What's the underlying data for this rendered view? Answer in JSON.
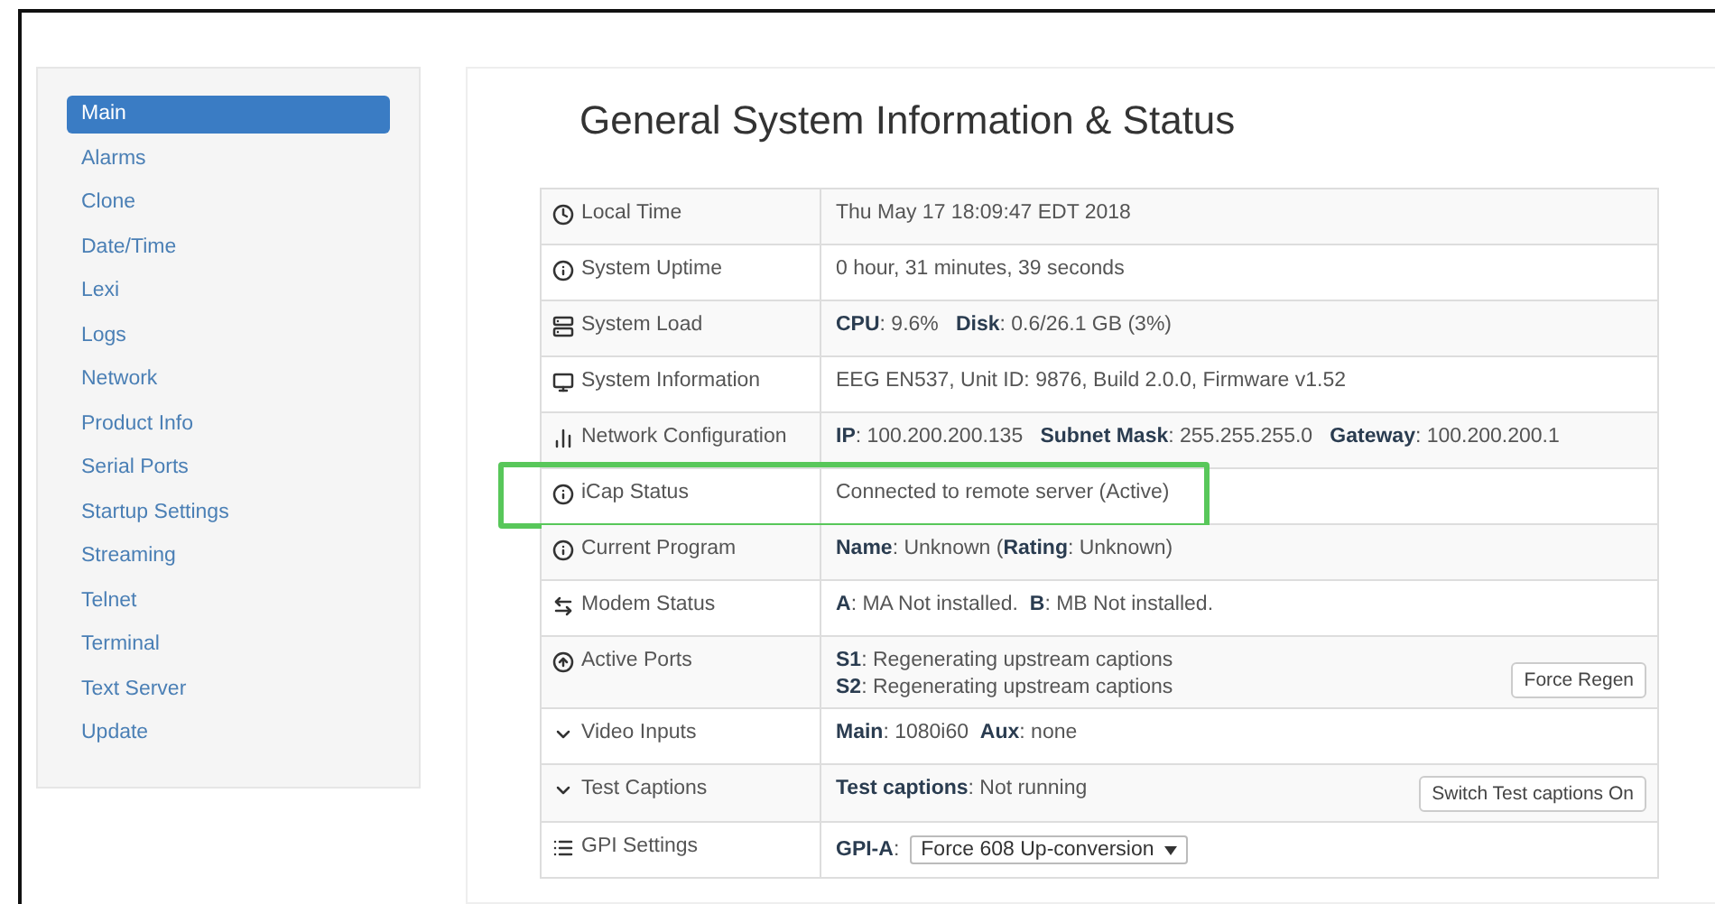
{
  "sidebar": {
    "items": [
      {
        "label": "Main",
        "selected": true
      },
      {
        "label": "Alarms",
        "selected": false
      },
      {
        "label": "Clone",
        "selected": false
      },
      {
        "label": "Date/Time",
        "selected": false
      },
      {
        "label": "Lexi",
        "selected": false
      },
      {
        "label": "Logs",
        "selected": false
      },
      {
        "label": "Network",
        "selected": false
      },
      {
        "label": "Product Info",
        "selected": false
      },
      {
        "label": "Serial Ports",
        "selected": false
      },
      {
        "label": "Startup Settings",
        "selected": false
      },
      {
        "label": "Streaming",
        "selected": false
      },
      {
        "label": "Telnet",
        "selected": false
      },
      {
        "label": "Terminal",
        "selected": false
      },
      {
        "label": "Text Server",
        "selected": false
      },
      {
        "label": "Update",
        "selected": false
      }
    ]
  },
  "title": "General System Information & Status",
  "table": {
    "rows": [
      {
        "label": "Local Time",
        "lines": [
          "Thu May 17 18:09:47 EDT 2018"
        ],
        "highlighted": false
      },
      {
        "label": "System Uptime",
        "lines": [
          "0 hour, 31 minutes, 39 seconds"
        ],
        "highlighted": false
      },
      {
        "label": "System Load",
        "lines": [
          "**CPU**: 9.6%   **Disk**: 0.6/26.1 GB (3%)"
        ],
        "highlighted": false
      },
      {
        "label": "System Information",
        "lines": [
          "EEG EN537, Unit ID: 9876, Build 2.0.0, Firmware v1.52"
        ],
        "highlighted": false
      },
      {
        "label": "Network Configuration",
        "lines": [
          "**IP**: 100.200.200.135   **Subnet Mask**: 255.255.255.0   **Gateway**: 100.200.200.1"
        ],
        "highlighted": false
      },
      {
        "label": "iCap Status",
        "lines": [
          "Connected to remote server (Active)"
        ],
        "highlighted": true
      },
      {
        "label": "Current Program",
        "lines": [
          "**Name**: Unknown (**Rating**: Unknown)"
        ],
        "highlighted": false
      },
      {
        "label": "Modem Status",
        "lines": [
          "**A**: MA Not installed.  **B**: MB Not installed."
        ],
        "highlighted": false
      },
      {
        "label": "Active Ports",
        "lines": [
          "**S1**: Regenerating upstream captions",
          "**S2**: Regenerating upstream captions"
        ],
        "button": "Force Regen",
        "highlighted": false
      },
      {
        "label": "Video Inputs",
        "lines": [
          "**Main**: 1080i60  **Aux**: none"
        ],
        "highlighted": false
      },
      {
        "label": "Test Captions",
        "lines": [
          "**Test captions**: Not running"
        ],
        "button": "Switch Test captions On",
        "highlighted": false
      },
      {
        "label": "GPI Settings",
        "lines": [
          "**GPI-A**:"
        ],
        "select": "Force 608 Up-conversion",
        "highlighted": false
      }
    ]
  }
}
